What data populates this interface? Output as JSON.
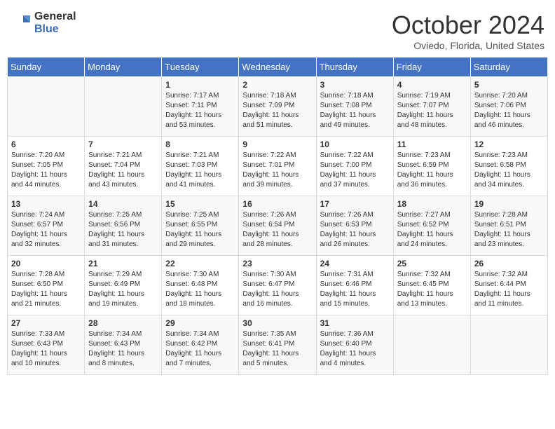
{
  "header": {
    "logo_general": "General",
    "logo_blue": "Blue",
    "month_title": "October 2024",
    "location": "Oviedo, Florida, United States"
  },
  "weekdays": [
    "Sunday",
    "Monday",
    "Tuesday",
    "Wednesday",
    "Thursday",
    "Friday",
    "Saturday"
  ],
  "weeks": [
    [
      {
        "day": "",
        "info": ""
      },
      {
        "day": "",
        "info": ""
      },
      {
        "day": "1",
        "info": "Sunrise: 7:17 AM\nSunset: 7:11 PM\nDaylight: 11 hours and 53 minutes."
      },
      {
        "day": "2",
        "info": "Sunrise: 7:18 AM\nSunset: 7:09 PM\nDaylight: 11 hours and 51 minutes."
      },
      {
        "day": "3",
        "info": "Sunrise: 7:18 AM\nSunset: 7:08 PM\nDaylight: 11 hours and 49 minutes."
      },
      {
        "day": "4",
        "info": "Sunrise: 7:19 AM\nSunset: 7:07 PM\nDaylight: 11 hours and 48 minutes."
      },
      {
        "day": "5",
        "info": "Sunrise: 7:20 AM\nSunset: 7:06 PM\nDaylight: 11 hours and 46 minutes."
      }
    ],
    [
      {
        "day": "6",
        "info": "Sunrise: 7:20 AM\nSunset: 7:05 PM\nDaylight: 11 hours and 44 minutes."
      },
      {
        "day": "7",
        "info": "Sunrise: 7:21 AM\nSunset: 7:04 PM\nDaylight: 11 hours and 43 minutes."
      },
      {
        "day": "8",
        "info": "Sunrise: 7:21 AM\nSunset: 7:03 PM\nDaylight: 11 hours and 41 minutes."
      },
      {
        "day": "9",
        "info": "Sunrise: 7:22 AM\nSunset: 7:01 PM\nDaylight: 11 hours and 39 minutes."
      },
      {
        "day": "10",
        "info": "Sunrise: 7:22 AM\nSunset: 7:00 PM\nDaylight: 11 hours and 37 minutes."
      },
      {
        "day": "11",
        "info": "Sunrise: 7:23 AM\nSunset: 6:59 PM\nDaylight: 11 hours and 36 minutes."
      },
      {
        "day": "12",
        "info": "Sunrise: 7:23 AM\nSunset: 6:58 PM\nDaylight: 11 hours and 34 minutes."
      }
    ],
    [
      {
        "day": "13",
        "info": "Sunrise: 7:24 AM\nSunset: 6:57 PM\nDaylight: 11 hours and 32 minutes."
      },
      {
        "day": "14",
        "info": "Sunrise: 7:25 AM\nSunset: 6:56 PM\nDaylight: 11 hours and 31 minutes."
      },
      {
        "day": "15",
        "info": "Sunrise: 7:25 AM\nSunset: 6:55 PM\nDaylight: 11 hours and 29 minutes."
      },
      {
        "day": "16",
        "info": "Sunrise: 7:26 AM\nSunset: 6:54 PM\nDaylight: 11 hours and 28 minutes."
      },
      {
        "day": "17",
        "info": "Sunrise: 7:26 AM\nSunset: 6:53 PM\nDaylight: 11 hours and 26 minutes."
      },
      {
        "day": "18",
        "info": "Sunrise: 7:27 AM\nSunset: 6:52 PM\nDaylight: 11 hours and 24 minutes."
      },
      {
        "day": "19",
        "info": "Sunrise: 7:28 AM\nSunset: 6:51 PM\nDaylight: 11 hours and 23 minutes."
      }
    ],
    [
      {
        "day": "20",
        "info": "Sunrise: 7:28 AM\nSunset: 6:50 PM\nDaylight: 11 hours and 21 minutes."
      },
      {
        "day": "21",
        "info": "Sunrise: 7:29 AM\nSunset: 6:49 PM\nDaylight: 11 hours and 19 minutes."
      },
      {
        "day": "22",
        "info": "Sunrise: 7:30 AM\nSunset: 6:48 PM\nDaylight: 11 hours and 18 minutes."
      },
      {
        "day": "23",
        "info": "Sunrise: 7:30 AM\nSunset: 6:47 PM\nDaylight: 11 hours and 16 minutes."
      },
      {
        "day": "24",
        "info": "Sunrise: 7:31 AM\nSunset: 6:46 PM\nDaylight: 11 hours and 15 minutes."
      },
      {
        "day": "25",
        "info": "Sunrise: 7:32 AM\nSunset: 6:45 PM\nDaylight: 11 hours and 13 minutes."
      },
      {
        "day": "26",
        "info": "Sunrise: 7:32 AM\nSunset: 6:44 PM\nDaylight: 11 hours and 11 minutes."
      }
    ],
    [
      {
        "day": "27",
        "info": "Sunrise: 7:33 AM\nSunset: 6:43 PM\nDaylight: 11 hours and 10 minutes."
      },
      {
        "day": "28",
        "info": "Sunrise: 7:34 AM\nSunset: 6:43 PM\nDaylight: 11 hours and 8 minutes."
      },
      {
        "day": "29",
        "info": "Sunrise: 7:34 AM\nSunset: 6:42 PM\nDaylight: 11 hours and 7 minutes."
      },
      {
        "day": "30",
        "info": "Sunrise: 7:35 AM\nSunset: 6:41 PM\nDaylight: 11 hours and 5 minutes."
      },
      {
        "day": "31",
        "info": "Sunrise: 7:36 AM\nSunset: 6:40 PM\nDaylight: 11 hours and 4 minutes."
      },
      {
        "day": "",
        "info": ""
      },
      {
        "day": "",
        "info": ""
      }
    ]
  ]
}
